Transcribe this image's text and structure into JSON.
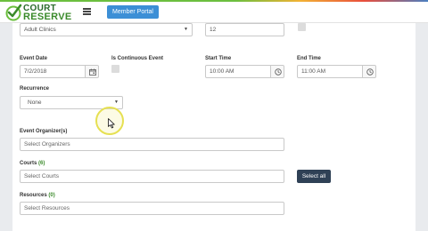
{
  "header": {
    "logo_top": "COURT",
    "logo_bottom": "RESERVE",
    "portal_button": "Member Portal"
  },
  "form": {
    "category_value": "Adult Clinics",
    "number_value": "12",
    "event_date": {
      "label": "Event Date",
      "value": "7/2/2018"
    },
    "continuous": {
      "label": "Is Continuous Event"
    },
    "start_time": {
      "label": "Start Time",
      "value": "10:00 AM"
    },
    "end_time": {
      "label": "End Time",
      "value": "11:00 AM"
    },
    "recurrence": {
      "label": "Recurrence",
      "value": "None"
    },
    "organizers": {
      "label": "Event Organizer(s)",
      "placeholder": "Select Organizers"
    },
    "courts": {
      "label": "Courts",
      "count": "(6)",
      "placeholder": "Select Courts",
      "select_all": "Select all"
    },
    "resources": {
      "label": "Resources",
      "count": "(0)",
      "placeholder": "Select Resources"
    }
  },
  "colors": {
    "brand_green": "#3a8a2a",
    "primary_blue": "#3c8fd6",
    "dark_button": "#2f4156"
  }
}
